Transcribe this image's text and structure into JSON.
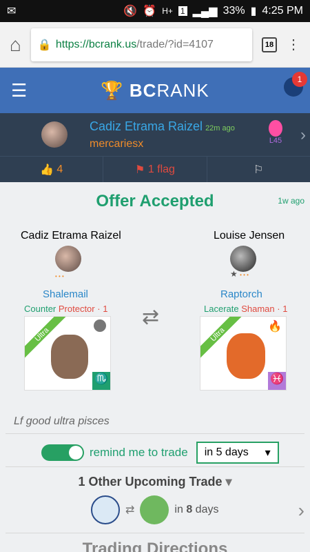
{
  "status": {
    "percent": "33%",
    "time": "4:25 PM",
    "sim": "1"
  },
  "browser": {
    "url_host": "https://bcrank.us",
    "url_path": "/trade/?id=4107",
    "tabs": "18"
  },
  "app": {
    "brand_left": "BC",
    "brand_right": "RANK",
    "notifications": "1"
  },
  "trade_user": {
    "name": "Cadiz Etrama Raizel",
    "time": "22m ago",
    "sub": "mercariesx",
    "level": "L45"
  },
  "actions": {
    "likes": "4",
    "flag": "1 flag"
  },
  "trade": {
    "ago": "1w ago",
    "status": "Offer Accepted",
    "left": {
      "owner": "Cadiz Etrama Raizel",
      "pet": "Shalemail",
      "trait1": "Counter",
      "trait2": "Protector",
      "level": "· 1",
      "rarity": "Ultra",
      "element": "rock",
      "zodiac": "♏"
    },
    "right": {
      "owner": "Louise Jensen",
      "pet": "Raptorch",
      "trait1": "Lacerate",
      "trait2": "Shaman",
      "level": "· 1",
      "rarity": "Ultra",
      "element": "fire",
      "zodiac": "♓"
    },
    "dots": "• • •"
  },
  "note": "Lf good ultra pisces",
  "reminder": {
    "label": "remind me to trade",
    "selected": "in 5 days"
  },
  "upcoming": {
    "title": "1 Other Upcoming Trade",
    "in": "in",
    "days": "8",
    "unit": "days"
  },
  "directions": {
    "title": "Trading Directions"
  }
}
